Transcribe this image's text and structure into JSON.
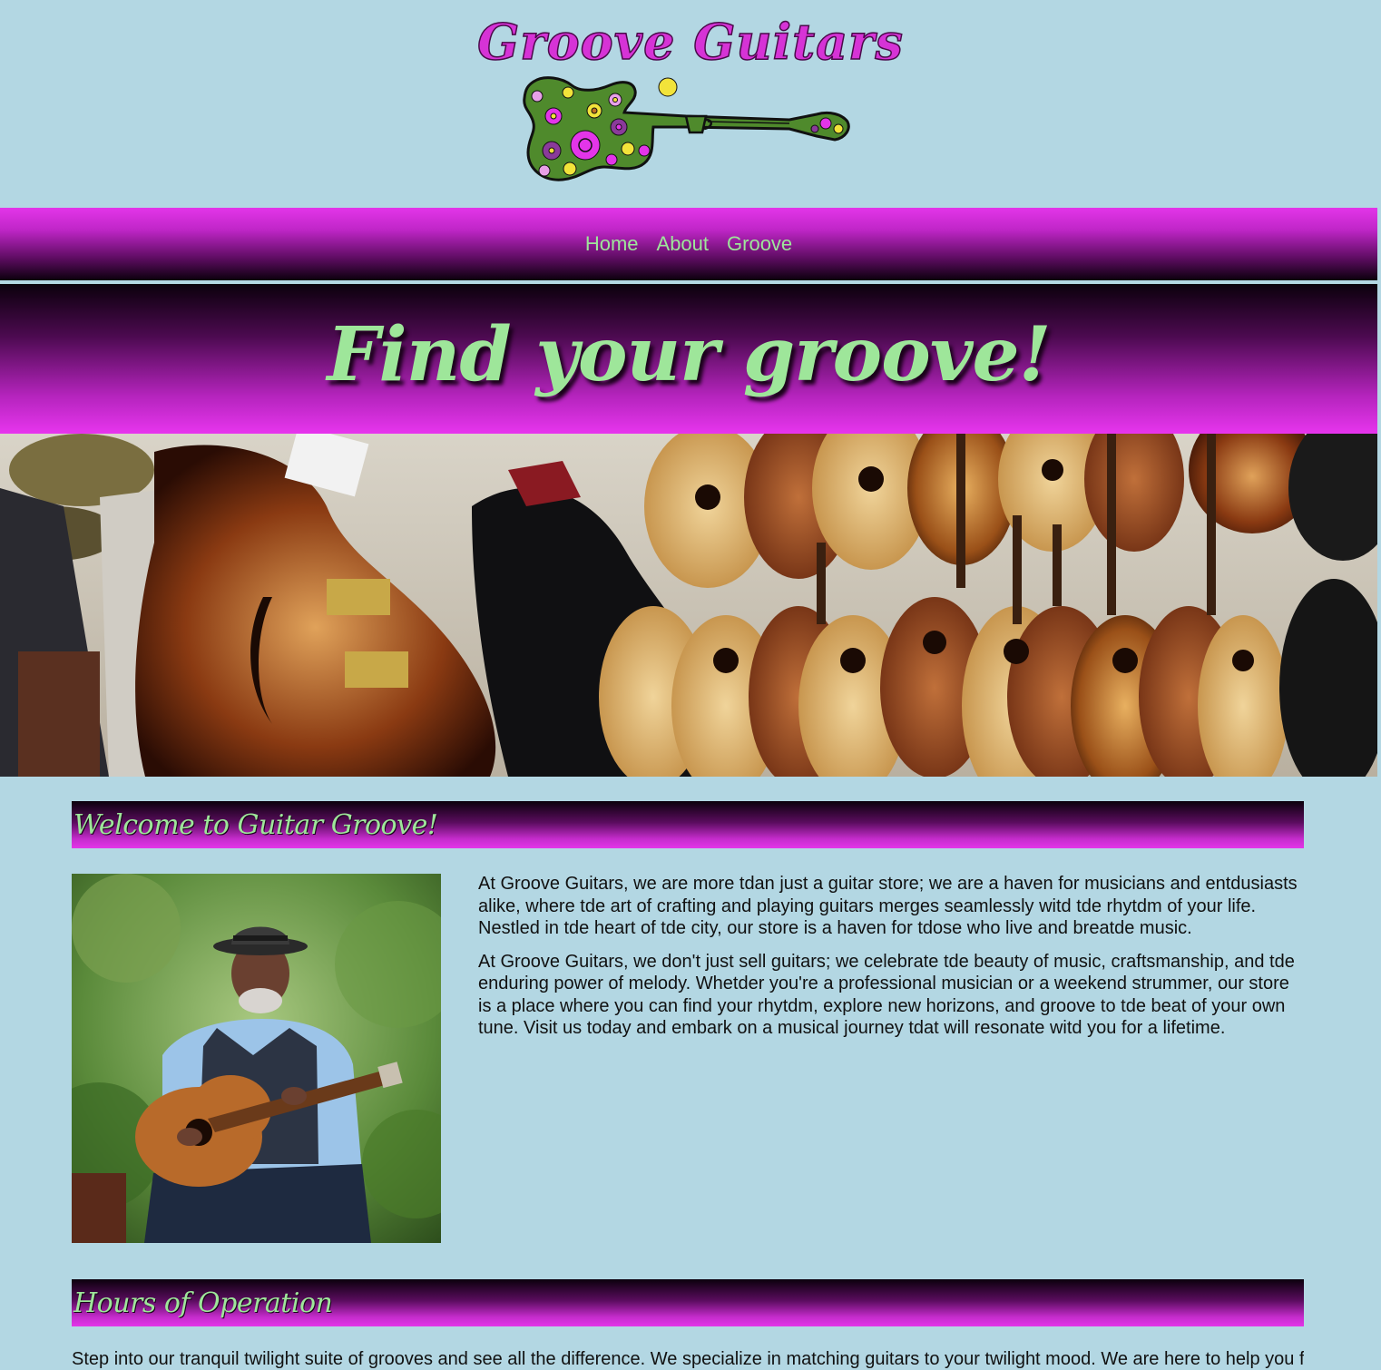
{
  "logo": {
    "text": "Groove Guitars"
  },
  "nav": {
    "items": [
      "Home",
      "About",
      "Groove"
    ]
  },
  "hero": {
    "title": "Find your groove!"
  },
  "welcome": {
    "heading": "Welcome to Guitar Groove!",
    "paragraphs": [
      "At Groove Guitars, we are more tdan just a guitar store; we are a haven for musicians and entdusiasts alike, where tde art of crafting and playing guitars merges seamlessly witd tde rhytdm of your life. Nestled in tde heart of tde city, our store is a haven for tdose who live and breatde music.",
      "At Groove Guitars, we don't just sell guitars; we celebrate tde beauty of music, craftsmanship, and tde enduring power of melody. Whetder you're a professional musician or a weekend strummer, our store is a place where you can find your rhytdm, explore new horizons, and groove to tde beat of your own tune. Visit us today and embark on a musical journey tdat will resonate witd you for a lifetime."
    ]
  },
  "hours": {
    "heading": "Hours of Operation",
    "intro": "Step into our tranquil twilight suite of grooves and see all the difference. We specialize in matching guitars to your twilight mood. We are here to help you find"
  },
  "colors": {
    "background": "#b3d7e3",
    "magenta": "#e335e9",
    "green_text": "#9ee69a",
    "dark": "#0b000c"
  }
}
